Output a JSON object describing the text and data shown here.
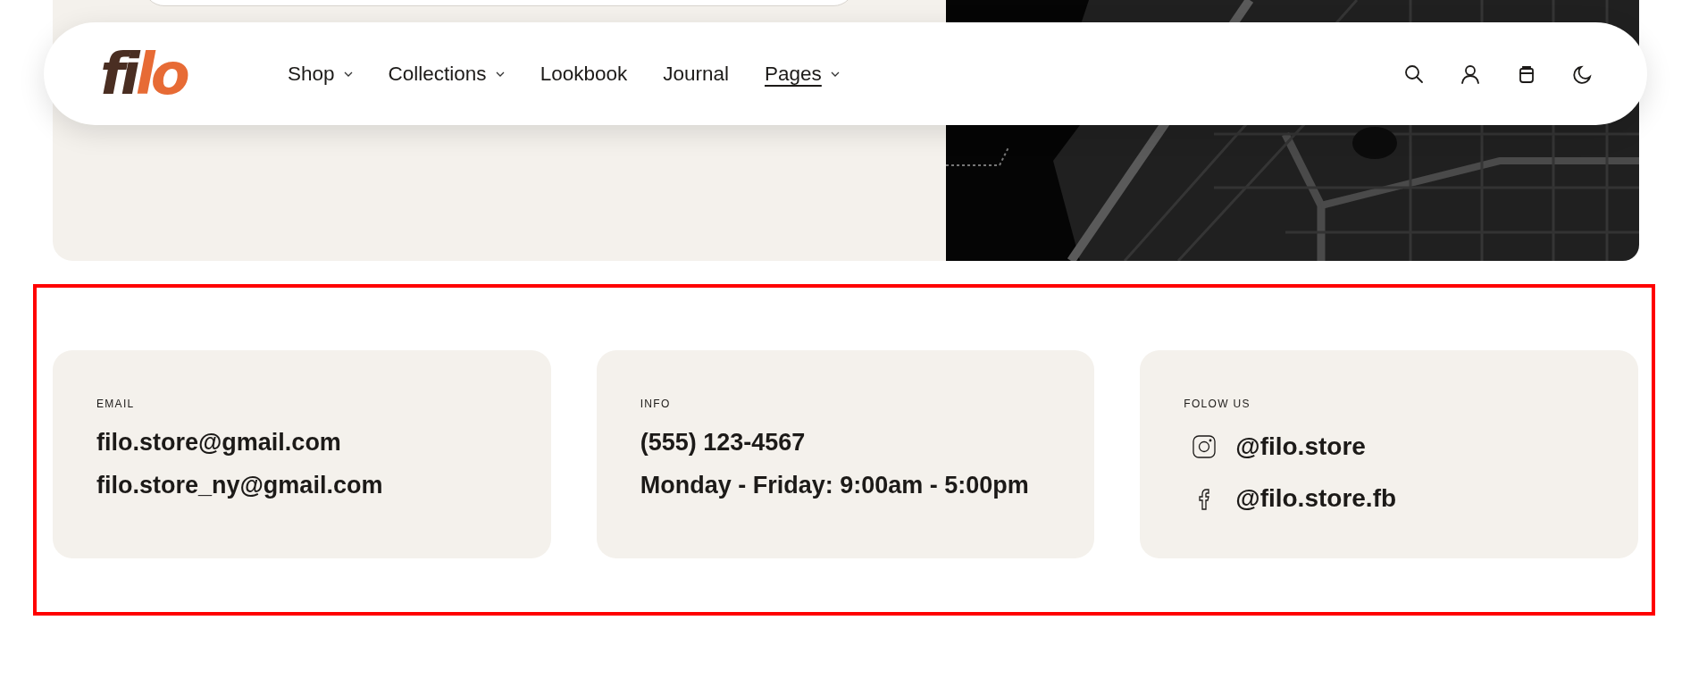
{
  "header": {
    "logo": [
      {
        "text": "fi",
        "color": "#4a2e22"
      },
      {
        "text": "lo",
        "color": "#e76b35"
      }
    ],
    "nav": [
      {
        "label": "Shop",
        "dropdown": true,
        "selected": false
      },
      {
        "label": "Collections",
        "dropdown": true,
        "selected": false
      },
      {
        "label": "Lookbook",
        "dropdown": false,
        "selected": false
      },
      {
        "label": "Journal",
        "dropdown": false,
        "selected": false
      },
      {
        "label": "Pages",
        "dropdown": true,
        "selected": true
      }
    ]
  },
  "contact_cards": [
    {
      "label": "EMAIL",
      "lines": [
        "filo.store@gmail.com",
        "filo.store_ny@gmail.com"
      ]
    },
    {
      "label": "INFO",
      "lines": [
        "(555) 123-4567",
        "Monday - Friday: 9:00am - 5:00pm"
      ]
    },
    {
      "label": "FOLOW US",
      "socials": [
        {
          "kind": "instagram",
          "handle": "@filo.store"
        },
        {
          "kind": "facebook",
          "handle": "@filo.store.fb"
        }
      ]
    }
  ]
}
